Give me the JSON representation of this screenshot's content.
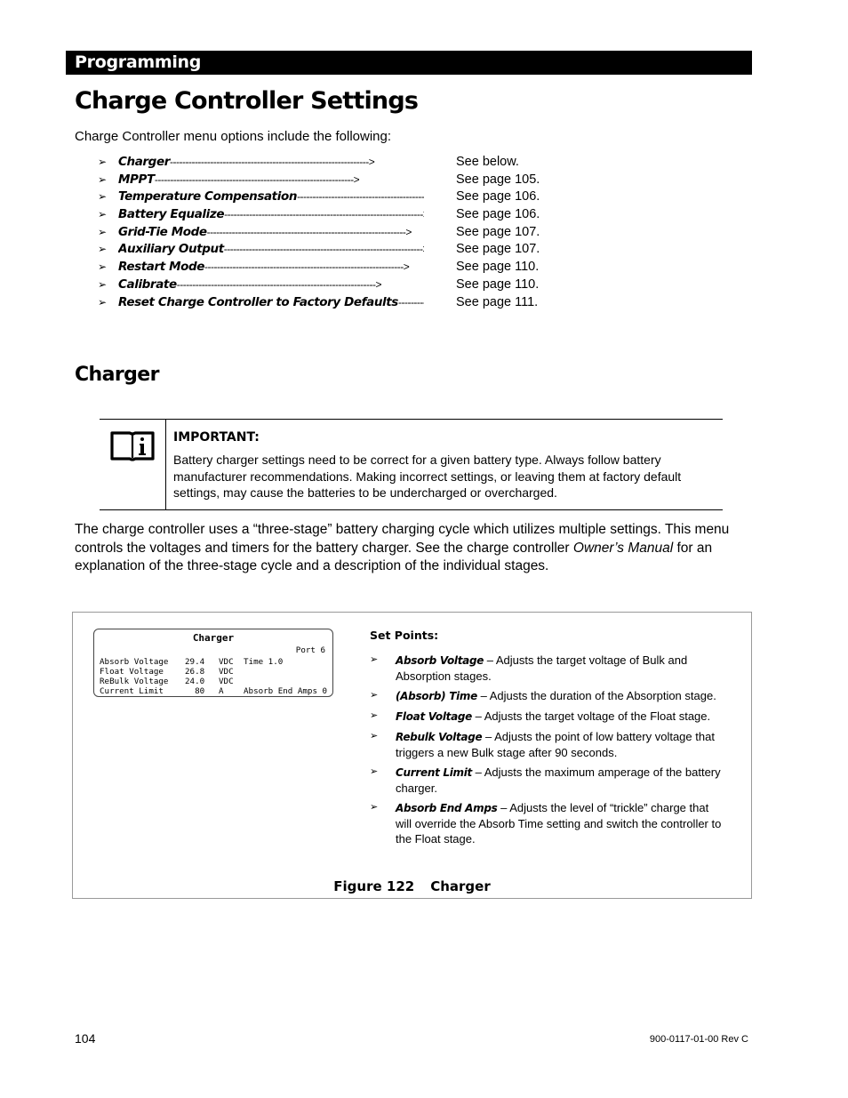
{
  "header": {
    "section": "Programming"
  },
  "title": "Charge Controller Settings",
  "intro": "Charge Controller menu options include the following:",
  "menu_items": [
    {
      "label": "Charger",
      "ref": "See below."
    },
    {
      "label": "MPPT",
      "ref": "See page 105."
    },
    {
      "label": "Temperature Compensation",
      "ref": "See page 106."
    },
    {
      "label": "Battery Equalize",
      "ref": "See page 106."
    },
    {
      "label": "Grid-Tie Mode",
      "ref": "See page 107."
    },
    {
      "label": "Auxiliary Output",
      "ref": "See page 107."
    },
    {
      "label": "Restart Mode",
      "ref": "See page 110."
    },
    {
      "label": "Calibrate",
      "ref": "See page 110."
    },
    {
      "label": "Reset Charge Controller to Factory Defaults",
      "ref": "See page 111."
    }
  ],
  "bullet_glyph": "➢",
  "arrow": "---------------------------------------------------------------->",
  "charger": {
    "heading": "Charger",
    "note": {
      "icon": "manual-info-icon",
      "title": "IMPORTANT:",
      "body": "Battery charger settings need to be correct for a given battery type.  Always follow battery manufacturer recommendations.  Making incorrect settings, or leaving them at factory default settings, may cause the batteries to be undercharged or overcharged."
    },
    "paragraph": {
      "before": "The charge controller uses a “three-stage” battery charging cycle which utilizes multiple settings.  This menu controls the voltages and timers for the battery charger.  See the charge controller ",
      "emphasis": "Owner’s Manual",
      "after": " for an explanation of the three-stage cycle and a description of the individual stages."
    }
  },
  "figure": {
    "screen": {
      "title": "Charger",
      "port": "Port 6",
      "rows": [
        {
          "name": "Absorb Voltage",
          "value": "29.4",
          "unit": "VDC",
          "extra": "Time 1.0"
        },
        {
          "name": "Float Voltage",
          "value": "26.8",
          "unit": "VDC",
          "extra": ""
        },
        {
          "name": "ReBulk Voltage",
          "value": "24.0",
          "unit": "VDC",
          "extra": ""
        },
        {
          "name": "Current Limit",
          "value": "  80",
          "unit": "A",
          "extra": "Absorb End Amps 0"
        }
      ]
    },
    "setpoints_title": "Set Points:",
    "setpoints": [
      {
        "term": "Absorb Voltage",
        "desc": " – Adjusts the target voltage of Bulk and Absorption stages."
      },
      {
        "term": "(Absorb) Time",
        "desc": " – Adjusts the duration of the Absorption stage."
      },
      {
        "term": "Float Voltage",
        "desc": " – Adjusts the target voltage of the Float stage."
      },
      {
        "term": "Rebulk Voltage",
        "desc": " – Adjusts the point of low battery voltage that triggers a new Bulk stage after 90 seconds."
      },
      {
        "term": "Current Limit",
        "desc": " – Adjusts the maximum amperage of the battery charger."
      },
      {
        "term": "Absorb End Amps",
        "desc": " – Adjusts the level of “trickle” charge that will override the Absorb Time setting and switch the controller to the Float stage."
      }
    ],
    "caption_number": "Figure 122",
    "caption_title": "Charger"
  },
  "footer": {
    "page": "104",
    "doc_id": "900-0117-01-00 Rev C"
  }
}
